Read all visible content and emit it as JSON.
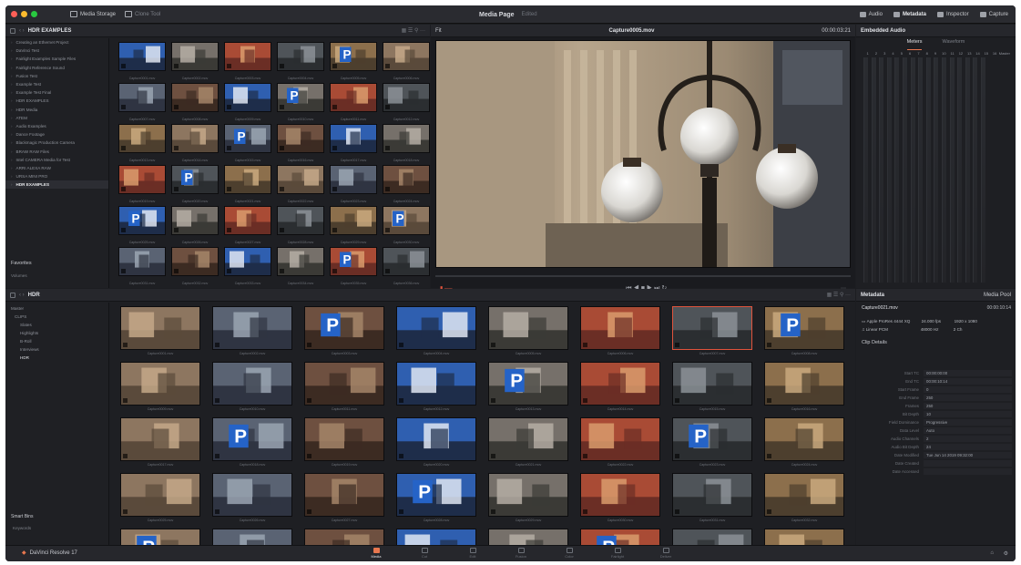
{
  "titlebar": {
    "media_storage_label": "Media Storage",
    "clone_tool_label": "Clone Tool",
    "page_title": "Media Page",
    "page_subtitle": "Edited",
    "right": [
      "Audio",
      "Metadata",
      "Inspector",
      "Capture"
    ]
  },
  "colors": {
    "traffic_red": "#ff5f57",
    "traffic_yellow": "#febc2e",
    "traffic_green": "#28c840",
    "accent": "#e8774f",
    "selection": "#e0533c"
  },
  "media_storage": {
    "path": "HDR EXAMPLES",
    "tree": [
      "Creating an Ethernet Project",
      "DaVinci Test",
      "Fairlight Examples Sample Files",
      "Fairlight Reference Sound",
      "Fusion Test",
      "Example Test",
      "Example Test Final",
      "HDR EXAMPLES",
      "HDR Media",
      "ATEM",
      "Audio Examples",
      "Dance Footage",
      "Blackmagic Production Camera",
      "BRAW RAW Files",
      "Intel CAMERA Media for Test",
      "ARRI ALEXA RAW",
      "URSA MINI PRO",
      "HDR EXAMPLES"
    ],
    "favorites_label": "Favorites",
    "favorites_item": "Volumes"
  },
  "storage_thumbs": [
    "Capture0001.mov",
    "Capture0002.mov",
    "Capture0003.mov",
    "Capture0004.mov",
    "Capture0005.mov",
    "Capture0006.mov",
    "Capture0007.mov",
    "Capture0008.mov",
    "Capture0009.mov",
    "Capture0010.mov",
    "Capture0011.mov",
    "Capture0012.mov",
    "Capture0013.mov",
    "Capture0014.mov",
    "Capture0015.mov",
    "Capture0016.mov",
    "Capture0017.mov",
    "Capture0018.mov",
    "Capture0019.mov",
    "Capture0020.mov",
    "Capture0021.mov",
    "Capture0022.mov",
    "Capture0023.mov",
    "Capture0024.mov",
    "Capture0025.mov",
    "Capture0026.mov",
    "Capture0027.mov",
    "Capture0028.mov",
    "Capture0029.mov",
    "Capture0030.mov",
    "Capture0031.mov",
    "Capture0032.mov",
    "Capture0033.mov",
    "Capture0034.mov",
    "Capture0035.mov",
    "Capture0036.mov"
  ],
  "viewer": {
    "zoom": "Fit",
    "clip": "Capture0005.mov",
    "timecode": "00:00:03:21",
    "timecode_left": "00:00:00:00"
  },
  "audio": {
    "title": "Embedded Audio",
    "tab_meters": "Meters",
    "tab_waveform": "Waveform",
    "channels": [
      "1",
      "2",
      "3",
      "4",
      "5",
      "6",
      "7",
      "8",
      "9",
      "10",
      "11",
      "12",
      "13",
      "14",
      "15",
      "16"
    ],
    "scale": "Master"
  },
  "media_pool": {
    "title": "HDR",
    "bins": [
      "Master",
      "CLIPS",
      "Slates",
      "Highlights",
      "B-Roll",
      "Interviews",
      "HDR"
    ],
    "smart_bins_label": "Smart Bins",
    "smart_bins_item": "Keywords",
    "clips": [
      "Capture0001.mov",
      "Capture0002.mov",
      "Capture0003.mov",
      "Capture0004.mov",
      "Capture0005.mov",
      "Capture0006.mov",
      "Capture0007.mov",
      "Capture0008.mov",
      "Capture0009.mov",
      "Capture0010.mov",
      "Capture0011.mov",
      "Capture0012.mov",
      "Capture0013.mov",
      "Capture0014.mov",
      "Capture0015.mov",
      "Capture0016.mov",
      "Capture0017.mov",
      "Capture0018.mov",
      "Capture0019.mov",
      "Capture0020.mov",
      "Capture0021.mov",
      "Capture0022.mov",
      "Capture0023.mov",
      "Capture0024.mov",
      "Capture0025.mov",
      "Capture0026.mov",
      "Capture0027.mov",
      "Capture0028.mov",
      "Capture0029.mov",
      "Capture0030.mov",
      "Capture0031.mov",
      "Capture0032.mov",
      "Capture0033.mov",
      "Capture0034.mov",
      "Capture0035.mov",
      "Capture0036.mov",
      "Capture0037.mov",
      "Capture0038.mov",
      "Capture0039.mov",
      "Capture0040.mov"
    ],
    "selected_index": 6
  },
  "metadata": {
    "title": "Metadata",
    "tab": "Media Pool",
    "clip_name": "Capture0021.mov",
    "clip_duration": "00:00:10:14",
    "codec": "Apple ProRes 4444 XQ",
    "fps": "24.000 fps",
    "resolution": "1920 x 1080",
    "audio": "Linear PCM",
    "audio_rate": "48000 Hz",
    "audio_ch": "2 Ch",
    "section": "Clip Details",
    "fields": [
      [
        "Start TC",
        "00:00:00:00"
      ],
      [
        "End TC",
        "00:00:10:14"
      ],
      [
        "Start Frame",
        "0"
      ],
      [
        "End Frame",
        "250"
      ],
      [
        "Frames",
        "250"
      ],
      [
        "Bit Depth",
        "10"
      ],
      [
        "Field Dominance",
        "Progressive"
      ],
      [
        "Data Level",
        "Auto"
      ],
      [
        "Audio Channels",
        "2"
      ],
      [
        "Audio Bit Depth",
        "24"
      ],
      [
        "Date Modified",
        "Tue Jun 14 2019 09:32:00"
      ],
      [
        "Date Created",
        ""
      ],
      [
        "Date Accessed",
        ""
      ]
    ]
  },
  "bottombar": {
    "app_name": "DaVinci Resolve 17",
    "pages": [
      "Media",
      "Cut",
      "Edit",
      "Fusion",
      "Color",
      "Fairlight",
      "Deliver"
    ],
    "active_page": "Media"
  }
}
